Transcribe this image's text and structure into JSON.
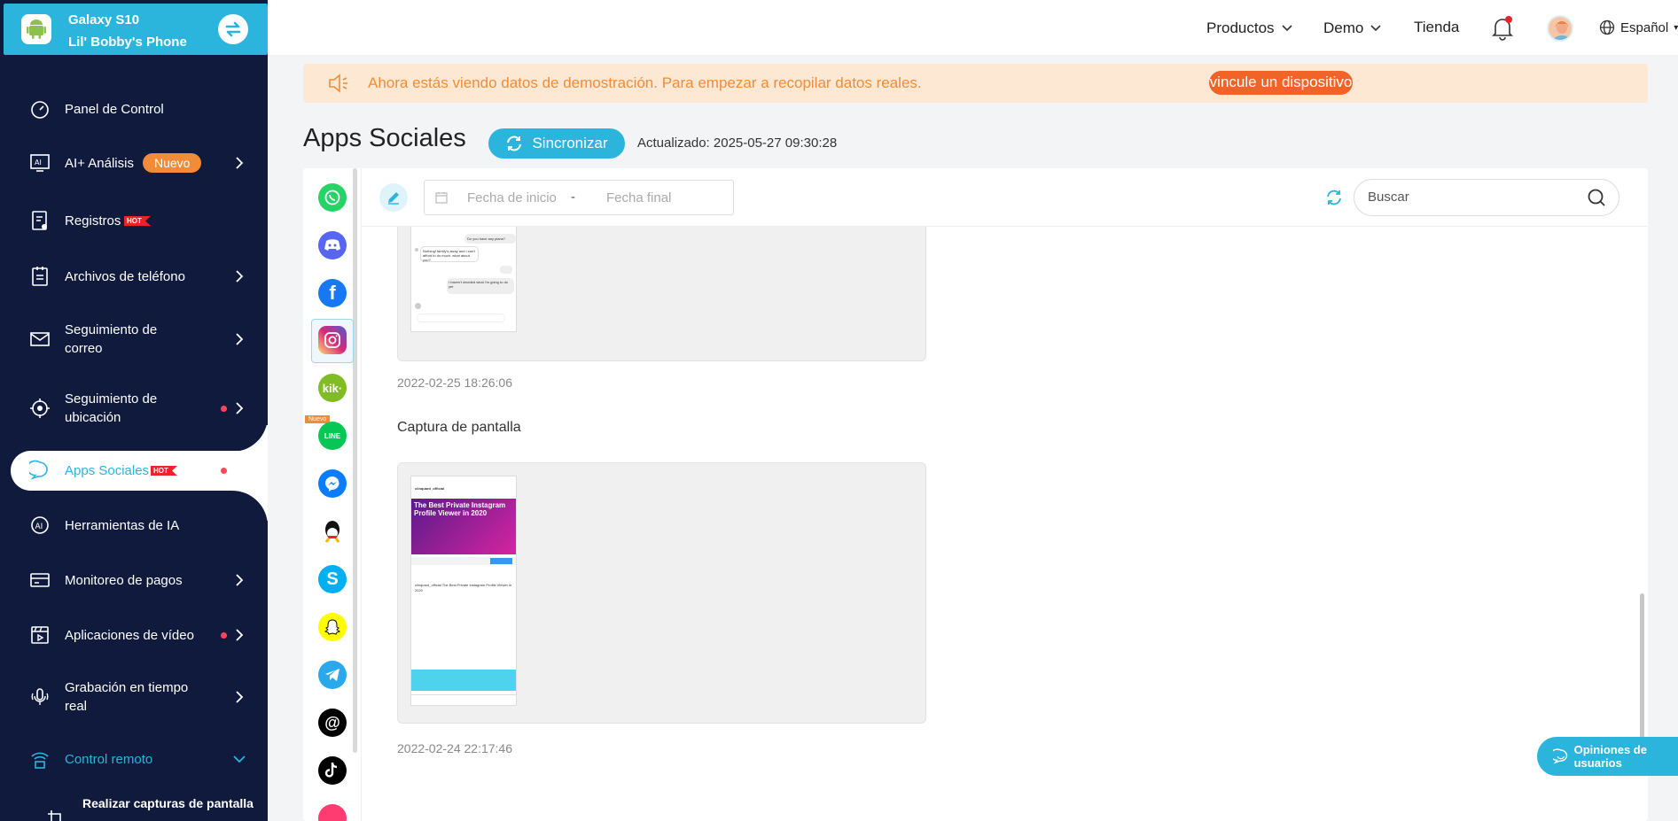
{
  "device": {
    "model": "Galaxy S10",
    "name": "Lil' Bobby's Phone"
  },
  "sidebar": {
    "items": [
      {
        "label": "Panel de Control",
        "icon": "dashboard-icon"
      },
      {
        "label": "AI+ Análisis",
        "badge": "Nuevo",
        "icon": "ai-analysis-icon"
      },
      {
        "label": "Registros",
        "tag": "HOT",
        "icon": "logs-icon"
      },
      {
        "label": "Archivos de teléfono",
        "icon": "phone-files-icon"
      },
      {
        "label": "Seguimiento de correo",
        "icon": "mail-icon"
      },
      {
        "label": "Seguimiento de ubicación",
        "icon": "location-icon"
      },
      {
        "label": "Apps Sociales",
        "tag": "HOT",
        "icon": "chat-icon"
      },
      {
        "label": "Herramientas de IA",
        "icon": "ai-tools-icon"
      },
      {
        "label": "Monitoreo de pagos",
        "icon": "payment-icon"
      },
      {
        "label": "Aplicaciones de vídeo",
        "icon": "video-icon"
      },
      {
        "label": "Grabación en tiempo real",
        "icon": "microphone-icon"
      },
      {
        "label": "Control remoto",
        "icon": "remote-icon"
      },
      {
        "label": "Realizar capturas de pantalla",
        "icon": "screenshot-icon"
      }
    ]
  },
  "header": {
    "products": "Productos",
    "demo": "Demo",
    "store": "Tienda",
    "language": "Español"
  },
  "banner": {
    "text": "Ahora estás viendo datos de demostración. Para empezar a recopilar datos reales.",
    "link": "vincule un dispositivo"
  },
  "page": {
    "title": "Apps Sociales",
    "sync": "Sincronizar",
    "updated": "Actualizado: 2025-05-27 09:30:28"
  },
  "toolbar": {
    "start_placeholder": "Fecha de inicio",
    "separator": "-",
    "end_placeholder": "Fecha final",
    "search_placeholder": "Buscar"
  },
  "apps": {
    "new_tag": "Nuevo",
    "list": [
      "WhatsApp",
      "Discord",
      "Facebook",
      "Instagram",
      "Kik",
      "LINE",
      "Messenger",
      "QQ",
      "Skype",
      "Snapchat",
      "Telegram",
      "Threads",
      "TikTok",
      "Tinder"
    ]
  },
  "feed": {
    "items": [
      {
        "time": "2022-02-25 18:26:06",
        "chat": [
          "Do you have any plans?",
          "Nothing! family's away and i can't afford to do much. what about you?",
          "I haven't decided what I'm going to do yet"
        ]
      },
      {
        "title": "Captura de pantalla",
        "time": "2022-02-24 22:17:46",
        "post": {
          "account": "clinquard_official",
          "headline": "The Best Private Instagram Profile Viewer in 2020",
          "caption": "clinquard_official The Best Private Instagram Profile Viewer in 2020"
        }
      }
    ]
  },
  "feedback": "Opiniones de usuarios",
  "colors": {
    "accent": "#2bb5dc",
    "sidebar": "#0f1a3d",
    "orange": "#f28c38"
  }
}
